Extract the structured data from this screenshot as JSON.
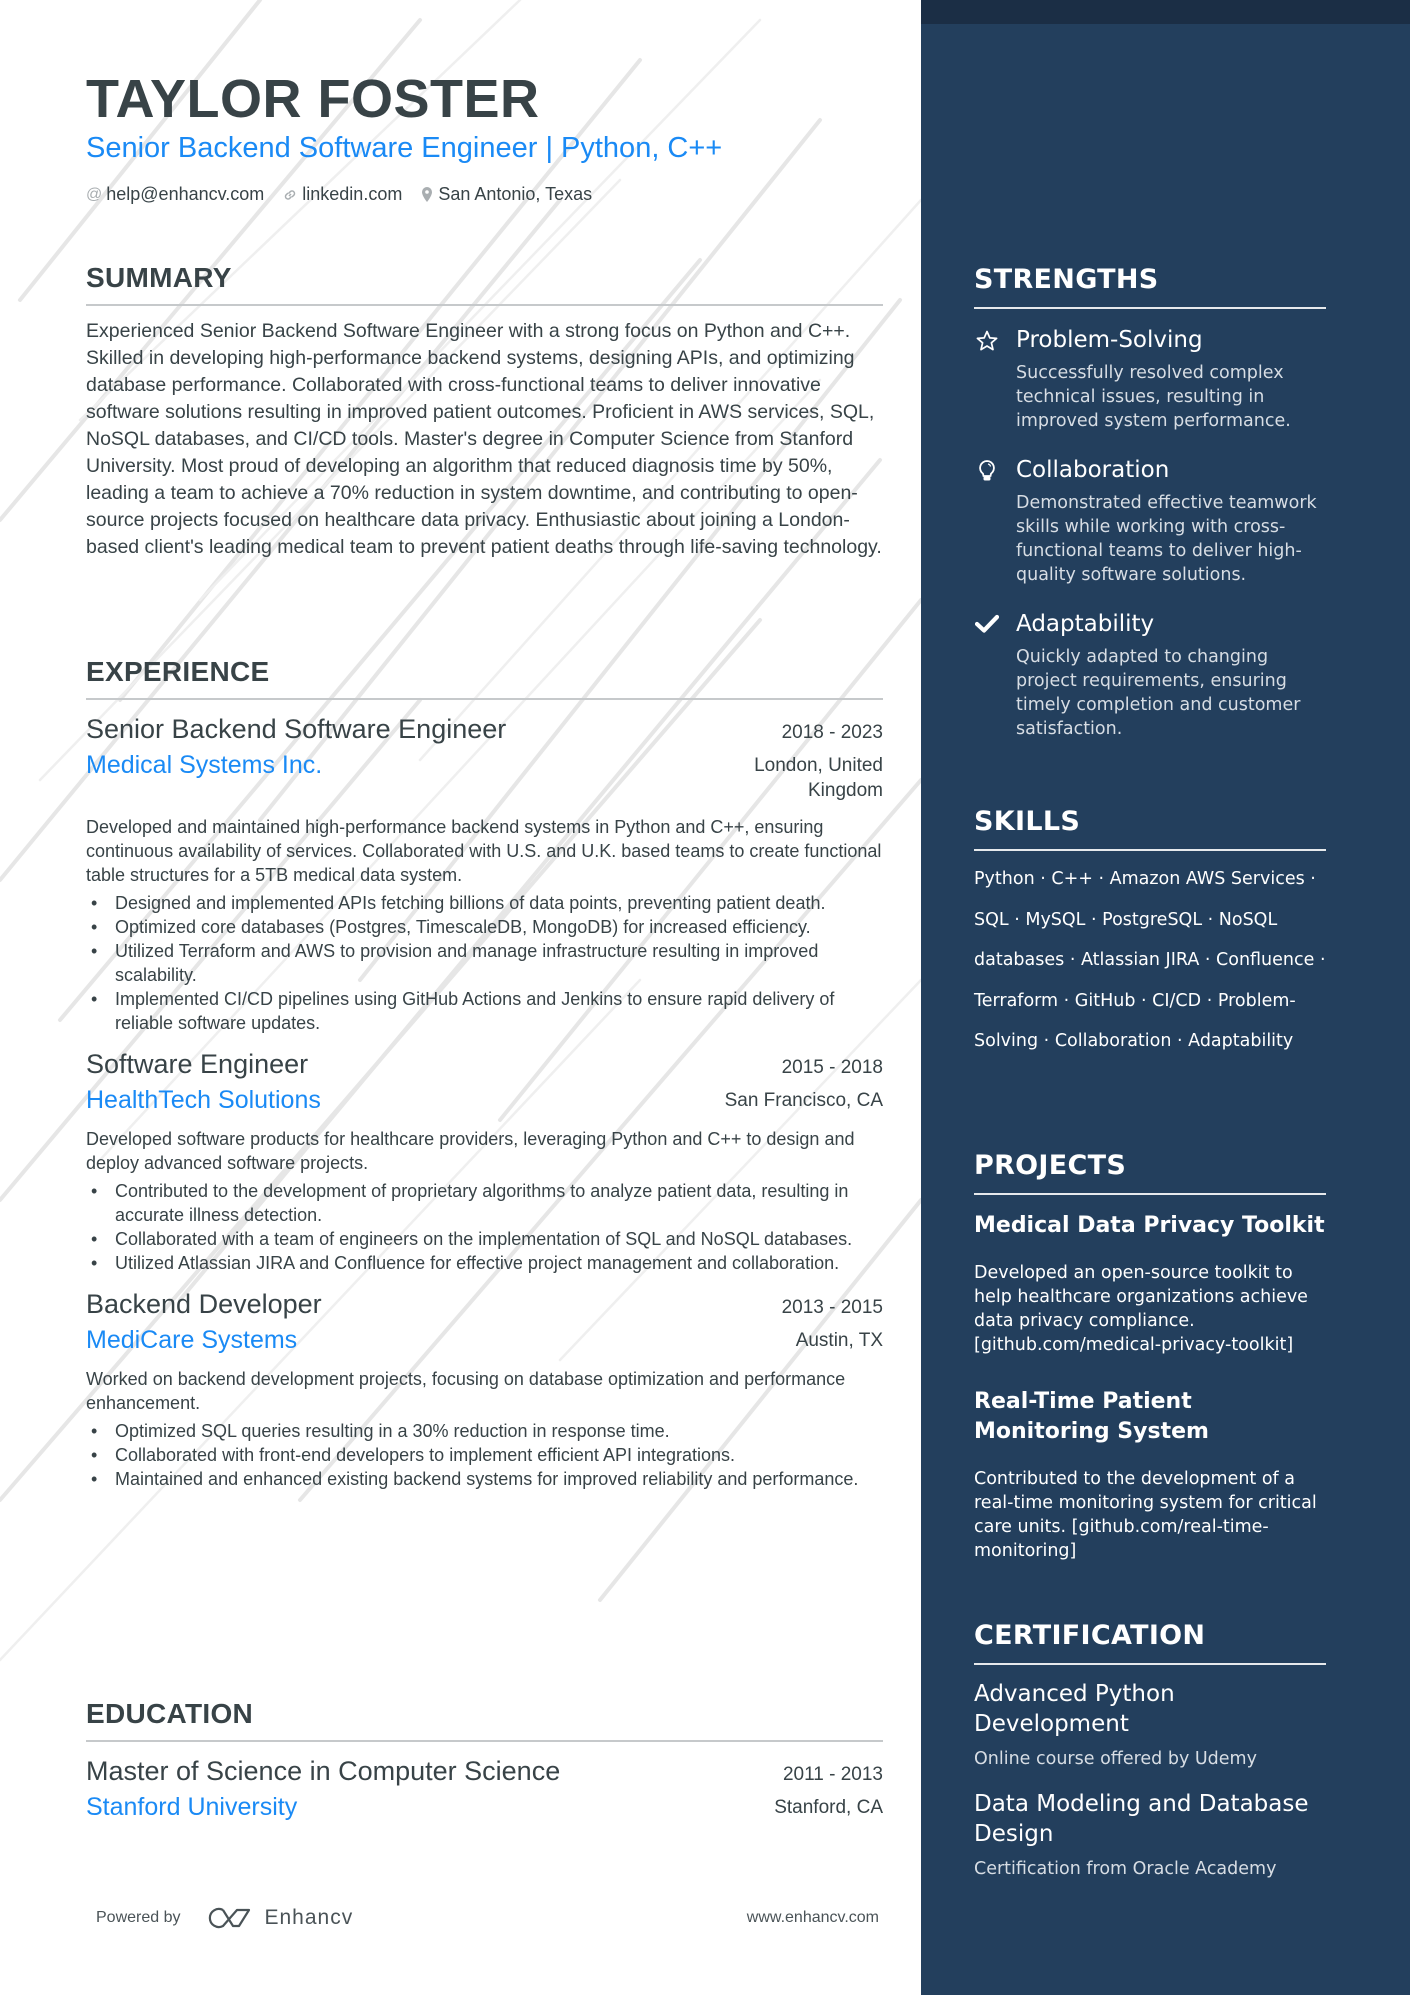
{
  "header": {
    "name": "TAYLOR FOSTER",
    "title": "Senior Backend Software Engineer | Python, C++",
    "contacts": [
      {
        "icon": "at-icon",
        "text": "help@enhancv.com"
      },
      {
        "icon": "link-icon",
        "text": "linkedin.com"
      },
      {
        "icon": "location-pin-icon",
        "text": "San Antonio, Texas"
      }
    ]
  },
  "summary": {
    "title": "SUMMARY",
    "text": "Experienced Senior Backend Software Engineer with a strong focus on Python and C++. Skilled in developing high-performance backend systems, designing APIs, and optimizing database performance. Collaborated with cross-functional teams to deliver innovative software solutions resulting in improved patient outcomes. Proficient in AWS services, SQL, NoSQL databases, and CI/CD tools. Master's degree in Computer Science from Stanford University. Most proud of developing an algorithm that reduced diagnosis time by 50%, leading a team to achieve a 70% reduction in system downtime, and contributing to open-source projects focused on healthcare data privacy. Enthusiastic about joining a London-based client's leading medical team to prevent patient deaths through life-saving technology."
  },
  "experience": {
    "title": "EXPERIENCE",
    "jobs": [
      {
        "role": "Senior Backend Software Engineer",
        "dates": "2018 - 2023",
        "company": "Medical Systems Inc.",
        "location": "London, United Kingdom",
        "description": "Developed and maintained high-performance backend systems in Python and C++, ensuring continuous availability of services. Collaborated with U.S. and U.K. based teams to create functional table structures for a 5TB medical data system.",
        "bullets": [
          "Designed and implemented APIs fetching billions of data points, preventing patient death.",
          "Optimized core databases (Postgres, TimescaleDB, MongoDB) for increased efficiency.",
          "Utilized Terraform and AWS to provision and manage infrastructure resulting in improved scalability.",
          "Implemented CI/CD pipelines using GitHub Actions and Jenkins to ensure rapid delivery of reliable software updates."
        ]
      },
      {
        "role": "Software Engineer",
        "dates": "2015 - 2018",
        "company": "HealthTech Solutions",
        "location": "San Francisco, CA",
        "description": "Developed software products for healthcare providers, leveraging Python and C++ to design and deploy advanced software projects.",
        "bullets": [
          "Contributed to the development of proprietary algorithms to analyze patient data, resulting in accurate illness detection.",
          "Collaborated with a team of engineers on the implementation of SQL and NoSQL databases.",
          "Utilized Atlassian JIRA and Confluence for effective project management and collaboration."
        ]
      },
      {
        "role": "Backend Developer",
        "dates": "2013 - 2015",
        "company": "MediCare Systems",
        "location": "Austin, TX",
        "description": "Worked on backend development projects, focusing on database optimization and performance enhancement.",
        "bullets": [
          "Optimized SQL queries resulting in a 30% reduction in response time.",
          "Collaborated with front-end developers to implement efficient API integrations.",
          "Maintained and enhanced existing backend systems for improved reliability and performance."
        ]
      }
    ]
  },
  "education": {
    "title": "EDUCATION",
    "items": [
      {
        "degree": "Master of Science in Computer Science",
        "dates": "2011 - 2013",
        "school": "Stanford University",
        "location": "Stanford, CA"
      }
    ]
  },
  "footer": {
    "powered_by": "Powered by",
    "brand": "Enhancv",
    "website": "www.enhancv.com"
  },
  "sidebar": {
    "strengths": {
      "title": "STRENGTHS",
      "items": [
        {
          "icon": "star-icon",
          "name": "Problem-Solving",
          "description": "Successfully resolved complex technical issues, resulting in improved system performance."
        },
        {
          "icon": "lightbulb-icon",
          "name": "Collaboration",
          "description": "Demonstrated effective teamwork skills while working with cross-functional teams to deliver high-quality software solutions."
        },
        {
          "icon": "checkmark-icon",
          "name": "Adaptability",
          "description": "Quickly adapted to changing project requirements, ensuring timely completion and customer satisfaction."
        }
      ]
    },
    "skills": {
      "title": "SKILLS",
      "items": [
        "Python",
        "C++",
        "Amazon AWS Services",
        "SQL",
        "MySQL",
        "PostgreSQL",
        "NoSQL databases",
        "Atlassian JIRA",
        "Confluence",
        "Terraform",
        "GitHub",
        "CI/CD",
        "Problem-Solving",
        "Collaboration",
        "Adaptability"
      ]
    },
    "projects": {
      "title": "PROJECTS",
      "items": [
        {
          "name": "Medical Data Privacy Toolkit",
          "description": "Developed an open-source toolkit to help healthcare organizations achieve data privacy compliance. [github.com/medical-privacy-toolkit]"
        },
        {
          "name": "Real-Time Patient Monitoring System",
          "description": "Contributed to the development of a real-time monitoring system for critical care units. [github.com/real-time-monitoring]"
        }
      ]
    },
    "certification": {
      "title": "CERTIFICATION",
      "items": [
        {
          "name": "Advanced Python Development",
          "description": "Online course offered by Udemy"
        },
        {
          "name": "Data Modeling and Database Design",
          "description": "Certification from Oracle Academy"
        }
      ]
    }
  },
  "colors": {
    "accent": "#1a8af5",
    "text": "#384347",
    "sidebar_bg": "#233f5d",
    "sidebar_strip": "#1b2e45"
  }
}
